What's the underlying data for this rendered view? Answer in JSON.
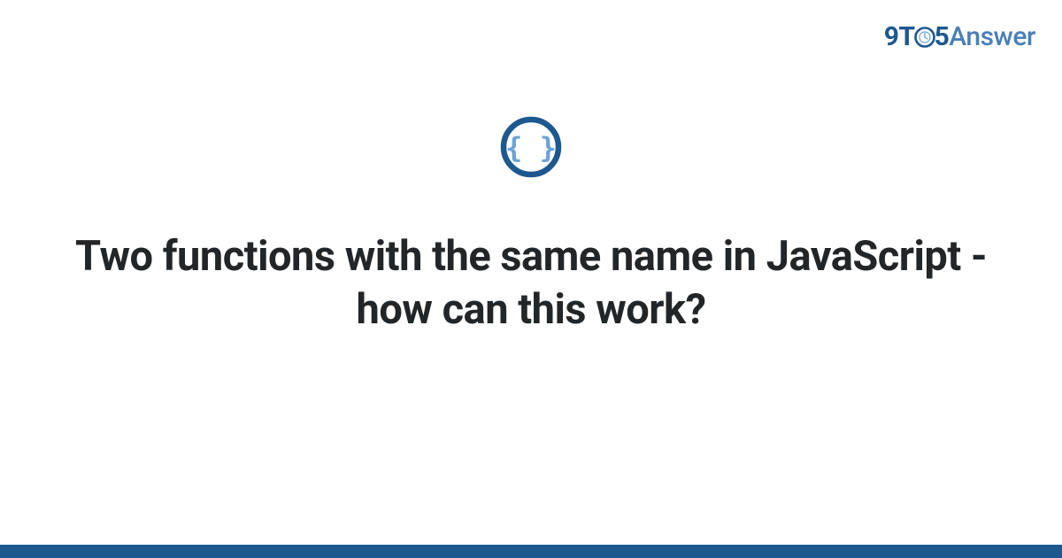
{
  "logo": {
    "nine": "9",
    "t": "T",
    "five": "5",
    "answer": "Answer"
  },
  "title": "Two functions with the same name in JavaScript - how can this work?",
  "colors": {
    "brand_dark": "#1d588f",
    "brand_light": "#4a7fb8",
    "icon_inner": "#6ba3d6",
    "text": "#232629"
  }
}
